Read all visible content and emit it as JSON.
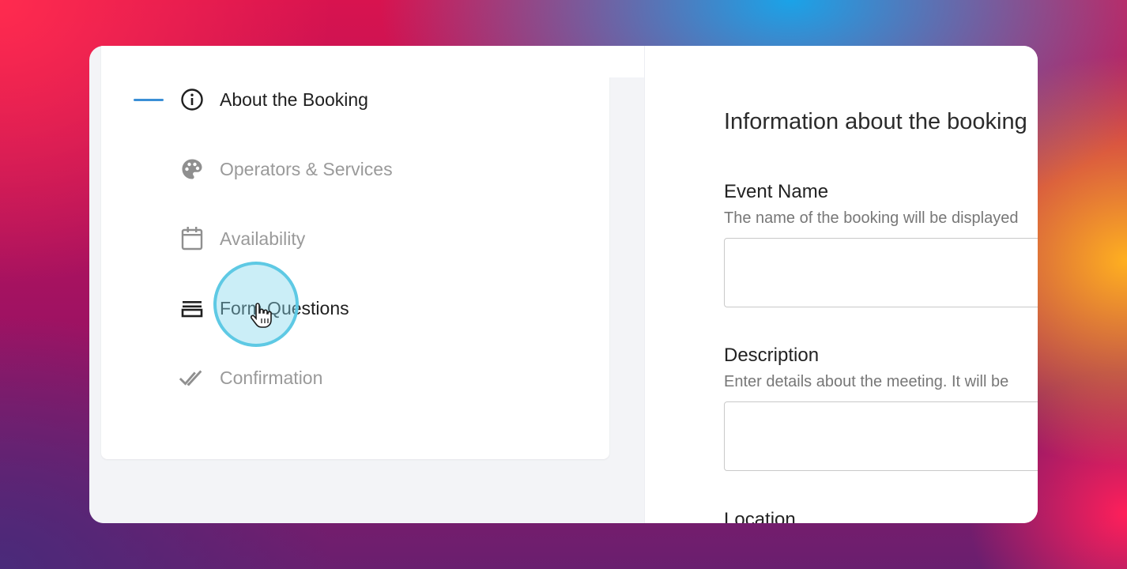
{
  "steps": [
    {
      "label": "About the Booking",
      "icon": "info-circle-icon",
      "state": "active"
    },
    {
      "label": "Operators & Services",
      "icon": "palette-icon",
      "state": "inactive"
    },
    {
      "label": "Availability",
      "icon": "calendar-icon",
      "state": "inactive"
    },
    {
      "label": "Form Questions",
      "icon": "list-lines-icon",
      "state": "hover"
    },
    {
      "label": "Confirmation",
      "icon": "double-check-icon",
      "state": "inactive"
    }
  ],
  "main": {
    "section_title": "Information about the booking",
    "fields": [
      {
        "label": "Event Name",
        "help": "The name of the booking will be displayed",
        "value": ""
      },
      {
        "label": "Description",
        "help": "Enter details about the meeting. It will be",
        "value": ""
      },
      {
        "label": "Location"
      }
    ]
  },
  "colors": {
    "accent": "#3a8fd6",
    "cursor_ring": "#5ec9e4"
  }
}
